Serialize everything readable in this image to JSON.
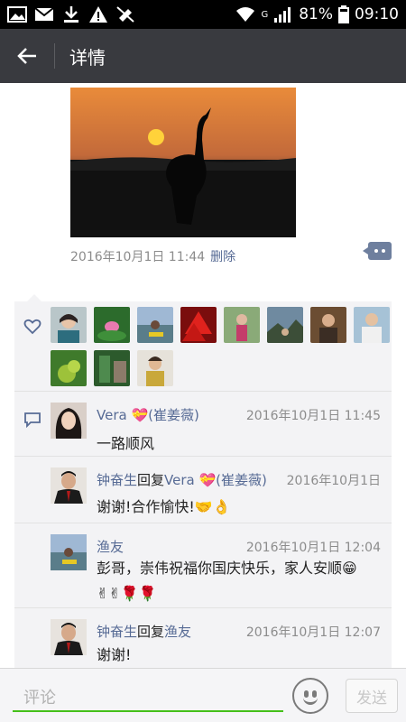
{
  "status_bar": {
    "network_label": "G",
    "battery_percent": "81%",
    "time": "09:10"
  },
  "header": {
    "title": "详情"
  },
  "post": {
    "timestamp": "2016年10月1日 11:44",
    "delete_label": "删除"
  },
  "likes": {
    "count": 11
  },
  "comments": [
    {
      "name": "Vera 💝(崔姜薇)",
      "reply_word": "",
      "reply_to": "",
      "time": "2016年10月1日 11:45",
      "text": "一路顺风"
    },
    {
      "name": "钟奋生",
      "reply_word": "回复",
      "reply_to": "Vera 💝(崔姜薇)",
      "time": "2016年10月1日",
      "text": "谢谢!合作愉快!🤝👌"
    },
    {
      "name": "渔友",
      "reply_word": "",
      "reply_to": "",
      "time": "2016年10月1日 12:04",
      "text": "彭哥，崇伟祝福你国庆快乐，家人安顺😁✌✌🌹🌹"
    },
    {
      "name": "钟奋生",
      "reply_word": "回复",
      "reply_to": "渔友",
      "time": "2016年10月1日 12:07",
      "text": "谢谢!"
    }
  ],
  "input_bar": {
    "placeholder": "评论",
    "send_label": "发送"
  },
  "colors": {
    "header_bg": "#393a3f",
    "link_blue": "#576b95",
    "accent_green": "#45c01a"
  }
}
